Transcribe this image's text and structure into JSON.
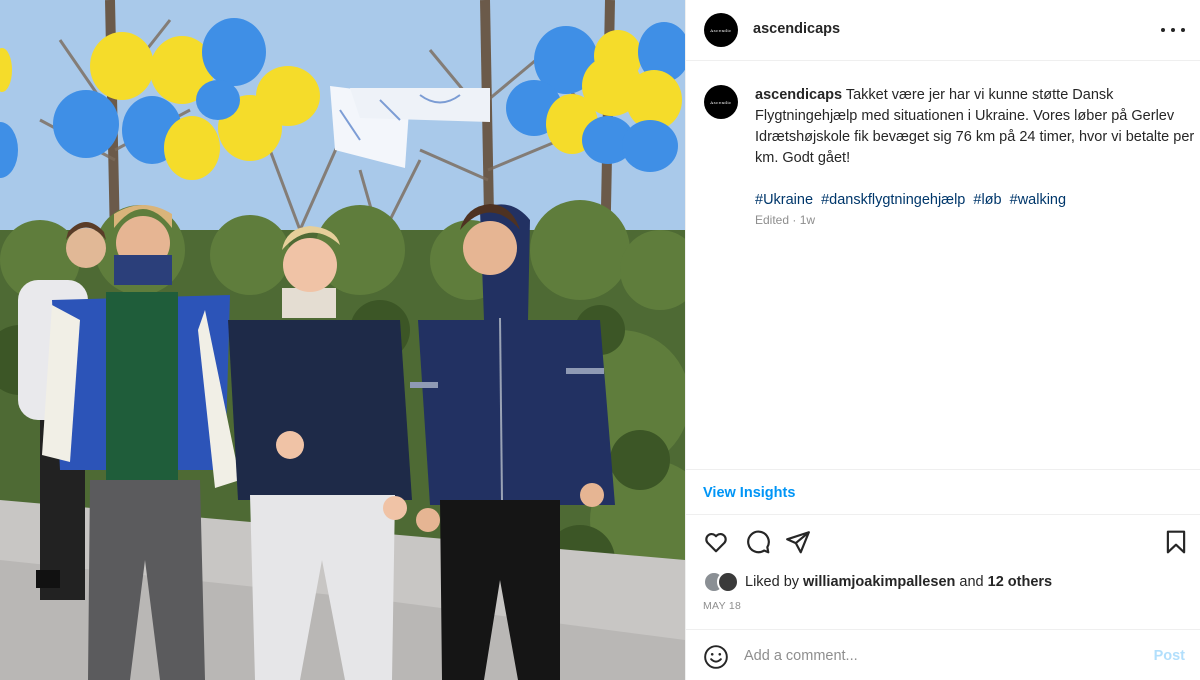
{
  "post": {
    "username": "ascendicaps",
    "avatar_text": "Ascendic",
    "caption": "Takket være jer har vi kunne støtte Dansk Flygtningehjælp med situationen i Ukraine. Vores løber på Gerlev Idrætshøjskole fik bevæget sig 76 km på 24 timer, hvor vi betalte per km. Godt gået!",
    "hashtags": [
      "#Ukraine",
      "#danskflygtningehjælp",
      "#løb",
      "#walking"
    ],
    "edited": "Edited · 1w",
    "view_insights": "View Insights",
    "likes": {
      "prefix": "Liked by",
      "liker": "williamjoakimpallesen",
      "connector": "and",
      "others": "12 others"
    },
    "date": "MAY 18",
    "comment": {
      "placeholder": "Add a comment...",
      "post_label": "Post"
    },
    "photo": {
      "description": "Four young people walking past a hedge under yellow and blue balloons",
      "balloon_colors": [
        "#f5dc2a",
        "#3f8fe6"
      ]
    }
  },
  "icons": {
    "more": "more-options-icon",
    "like": "heart-icon",
    "comment": "comment-icon",
    "share": "share-icon",
    "save": "bookmark-icon",
    "emoji": "emoji-icon"
  }
}
